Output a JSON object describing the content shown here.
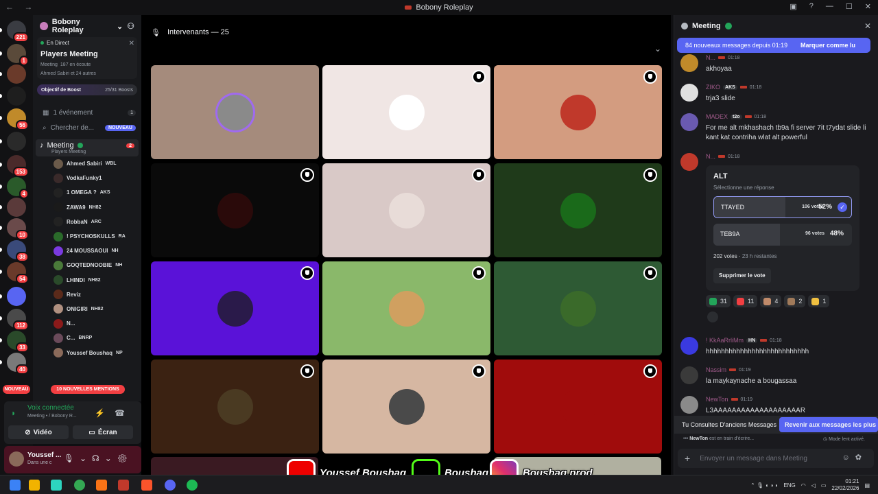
{
  "window": {
    "title": "Bobony Roleplay",
    "nav": "← →"
  },
  "rail": {
    "servers": [
      {
        "badge": "221",
        "color": "#3a3c42"
      },
      {
        "badge": "1",
        "color": "#5a4a3a"
      },
      {
        "badge": "",
        "color": "#6a3a2a"
      },
      {
        "badge": "",
        "color": "#1e1e1e"
      },
      {
        "badge": "56",
        "color": "#c08a2a"
      },
      {
        "badge": "",
        "color": "#2a2a2a"
      },
      {
        "badge": "153",
        "color": "#4a2a2a"
      },
      {
        "badge": "4",
        "color": "#2a5a2a"
      },
      {
        "badge": "",
        "color": "#5a3a3a"
      },
      {
        "badge": "10",
        "color": "#6a4a4a"
      },
      {
        "badge": "38",
        "color": "#3a4a7a"
      },
      {
        "badge": "54",
        "color": "#6a3a2a"
      },
      {
        "badge": "",
        "color": "#5865f2"
      },
      {
        "badge": "112",
        "color": "#4a4a4a"
      },
      {
        "badge": "33",
        "color": "#2a4a2a"
      },
      {
        "badge": "40",
        "color": "#7a7a7a"
      }
    ],
    "new_label": "NOUVEAU"
  },
  "sidebar": {
    "guild_name": "Bobony Roleplay",
    "live": {
      "tag": "En Direct",
      "title": "Players Meeting",
      "channel": "Meeting",
      "listeners": "187 en écoute",
      "people": "Ahmed Sabiri et 24 autres"
    },
    "boost": {
      "label": "Objectif de Boost",
      "value": "25/31 Boosts"
    },
    "events": {
      "label": "1 événement",
      "count": "1"
    },
    "search": {
      "label": "Chercher de...",
      "badge": "NOUVEAU"
    },
    "voice_channel": {
      "name": "Meeting",
      "count": "2",
      "desc": "Players Meeting"
    },
    "users": [
      {
        "name": "Ahmed Sabiri",
        "tag": "WBL",
        "color": "#6a5a4a"
      },
      {
        "name": "VodkaFunky1",
        "tag": "",
        "color": "#3a2a2a"
      },
      {
        "name": "1 OMEGA ?",
        "tag": "AKS",
        "color": "#222"
      },
      {
        "name": "ZAWA9",
        "tag": "NH82",
        "color": "#1a1a1a"
      },
      {
        "name": "RobbaN",
        "tag": "ARC",
        "color": "#222"
      },
      {
        "name": "! PSYCHOSKULLS",
        "tag": "RA",
        "color": "#2a6a2a"
      },
      {
        "name": "24 MOUSSAOUI",
        "tag": "NH",
        "color": "#7a3ae0"
      },
      {
        "name": "GOQTEDNOOBIE",
        "tag": "NH",
        "color": "#4a7a3a"
      },
      {
        "name": "LHINDI",
        "tag": "NH82",
        "color": "#2a4a2a"
      },
      {
        "name": "Reviz",
        "tag": "",
        "color": "#5a2a1a"
      },
      {
        "name": "ONIGIRI",
        "tag": "NH82",
        "color": "#b09080"
      },
      {
        "name": "N...",
        "tag": "",
        "color": "#8a1a1a"
      },
      {
        "name": "C...",
        "tag": "BNRP",
        "color": "#6a4a5a"
      },
      {
        "name": "Youssef Boushaq",
        "tag": "NP",
        "color": "#8a6a5a"
      }
    ],
    "mentions": "10 NOUVELLES MENTIONS"
  },
  "voice_panel": {
    "status": "Voix connectée",
    "where": "Meeting • / Bobony R...",
    "video": "Vidéo",
    "screen": "Écran"
  },
  "user_panel": {
    "name": "Youssef ...",
    "status": "Dans une c"
  },
  "stage": {
    "header": "Intervenants — 25",
    "tiles": [
      {
        "bg": "#a58b7c",
        "av": "#8a8a8a",
        "shield": false,
        "ring": "#a06af0"
      },
      {
        "bg": "#f0e6e4",
        "av": "#ffffff",
        "shield": true,
        "ring": ""
      },
      {
        "bg": "#d39c80",
        "av": "#c0392b",
        "shield": true,
        "ring": ""
      },
      {
        "bg": "#0a0a0a",
        "av": "#2a0a0a",
        "shield": true,
        "ring": ""
      },
      {
        "bg": "#d9c9c7",
        "av": "#e8dcd8",
        "shield": true,
        "ring": ""
      },
      {
        "bg": "#1f3a1a",
        "av": "#1a6a1a",
        "shield": true,
        "ring": ""
      },
      {
        "bg": "#5a12d8",
        "av": "#2a1a4a",
        "shield": true,
        "ring": ""
      },
      {
        "bg": "#8ab86a",
        "av": "#d0a060",
        "shield": true,
        "ring": ""
      },
      {
        "bg": "#2e5a34",
        "av": "#3a6a2a",
        "shield": true,
        "ring": ""
      },
      {
        "bg": "#3b2212",
        "av": "#4a3a22",
        "shield": true,
        "ring": ""
      },
      {
        "bg": "#d6b7a2",
        "av": "#4a4a4a",
        "shield": true,
        "ring": ""
      },
      {
        "bg": "#a00c0c",
        "av": "#a00c0c",
        "shield": true,
        "ring": ""
      }
    ]
  },
  "chat": {
    "channel": "Meeting",
    "new_bar": "84 nouveaux messages depuis 01:19",
    "mark_read": "Marquer comme lu",
    "messages": [
      {
        "author": "N...",
        "time": "01:18",
        "tag": "",
        "text": "akhoyaa",
        "av": "#c08a2a"
      },
      {
        "author": "ZIKO",
        "time": "01:18",
        "tag": "AKS",
        "text": "trja3 slide",
        "av": "#e0e0e0"
      },
      {
        "author": "MADEX",
        "time": "01:18",
        "tag": "t2o",
        "text": "For me alt mkhashach tb9a fi server 7it t7ydat slide li kant kat contriha wlat alt powerful",
        "av": "#6a5ab0"
      },
      {
        "author": "N...",
        "time": "01:18",
        "tag": "",
        "text": "",
        "av": "#c0392b"
      }
    ],
    "poll": {
      "question": "ALT",
      "hint": "Sélectionne une réponse",
      "options": [
        {
          "label": "TTAYED",
          "votes": "106 votes",
          "pct": "52%",
          "fraction": 0.52,
          "selected": true
        },
        {
          "label": "TEB9A",
          "votes": "96 votes",
          "pct": "48%",
          "fraction": 0.48,
          "selected": false
        }
      ],
      "total": "202 votes",
      "remaining": "23 h restantes",
      "remove": "Supprimer le vote"
    },
    "reactions": [
      {
        "count": "31",
        "color": "#23a55a"
      },
      {
        "count": "11",
        "color": "#f23f42"
      },
      {
        "count": "4",
        "color": "#c08a6a"
      },
      {
        "count": "2",
        "color": "#a07a5a"
      },
      {
        "count": "1",
        "color": "#f0c040"
      }
    ],
    "later_messages": [
      {
        "author": "! KkAaRrliMm",
        "time": "01:18",
        "tag": "HN",
        "text": "hhhhhhhhhhhhhhhhhhhhhhhhhhh",
        "av": "#3a3ae0"
      },
      {
        "author": "Nassim",
        "time": "01:19",
        "tag": "",
        "text": "la maykaynache a bougassaa",
        "av": "#3a3a3a"
      },
      {
        "author": "NewTon",
        "time": "01:19",
        "tag": "",
        "text": "L3AAAAAAAAAAAAAAAAAAAR",
        "av": "#8a8a8a"
      }
    ],
    "old_notice": "Tu Consultes D'anciens Messages",
    "jump": "Revenir aux messages les plus réc",
    "typing_user": "NewTon",
    "typing_text": "est en train d'écrire...",
    "slow_mode": "Mode lent activé.",
    "composer_placeholder": "Envoyer un message dans Meeting"
  },
  "banner": {
    "youtube": "Youssef Boushaq",
    "kick": "Boushaq",
    "instagram": "Boushaq.prod"
  },
  "taskbar": {
    "lang": "ENG",
    "time": "01:21",
    "date": "22/02/2026"
  }
}
